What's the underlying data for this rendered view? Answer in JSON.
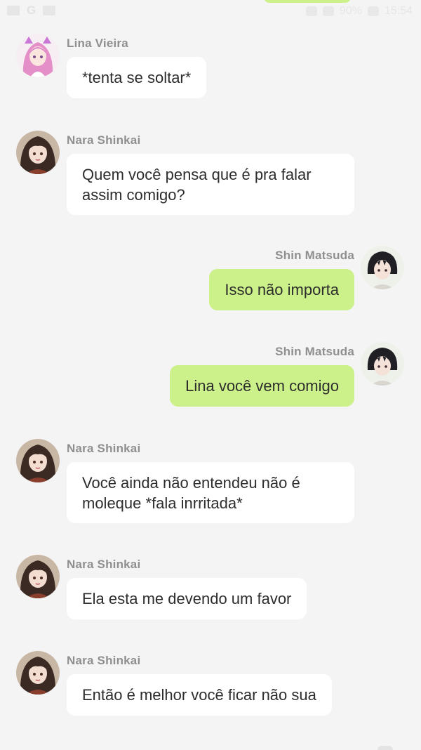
{
  "status_bar": {
    "battery": "90%",
    "time": "15:54"
  },
  "colors": {
    "background": "#f4f4f4",
    "incoming_bubble": "#ffffff",
    "outgoing_bubble": "#ccf18a",
    "name_text": "#8f8f8f",
    "message_text": "#2d2d2d"
  },
  "messages": [
    {
      "sender": "Lina Vieira",
      "side": "left",
      "avatar": "pink-hair-avatar",
      "text": "*tenta se soltar*"
    },
    {
      "sender": "Nara Shinkai",
      "side": "left",
      "avatar": "dark-hair-girl-avatar",
      "text": "Quem você pensa que é pra falar assim comigo?"
    },
    {
      "sender": "Shin Matsuda",
      "side": "right",
      "avatar": "dark-hair-boy-avatar",
      "text": "Isso não importa"
    },
    {
      "sender": "Shin Matsuda",
      "side": "right",
      "avatar": "dark-hair-boy-avatar",
      "text": "Lina você vem comigo"
    },
    {
      "sender": "Nara Shinkai",
      "side": "left",
      "avatar": "dark-hair-girl-avatar",
      "text": "Você ainda não entendeu não é moleque *fala inrritada*"
    },
    {
      "sender": "Nara Shinkai",
      "side": "left",
      "avatar": "dark-hair-girl-avatar",
      "text": "Ela esta me devendo um favor"
    },
    {
      "sender": "Nara Shinkai",
      "side": "left",
      "avatar": "dark-hair-girl-avatar",
      "text": "Então é melhor você ficar não sua"
    }
  ]
}
